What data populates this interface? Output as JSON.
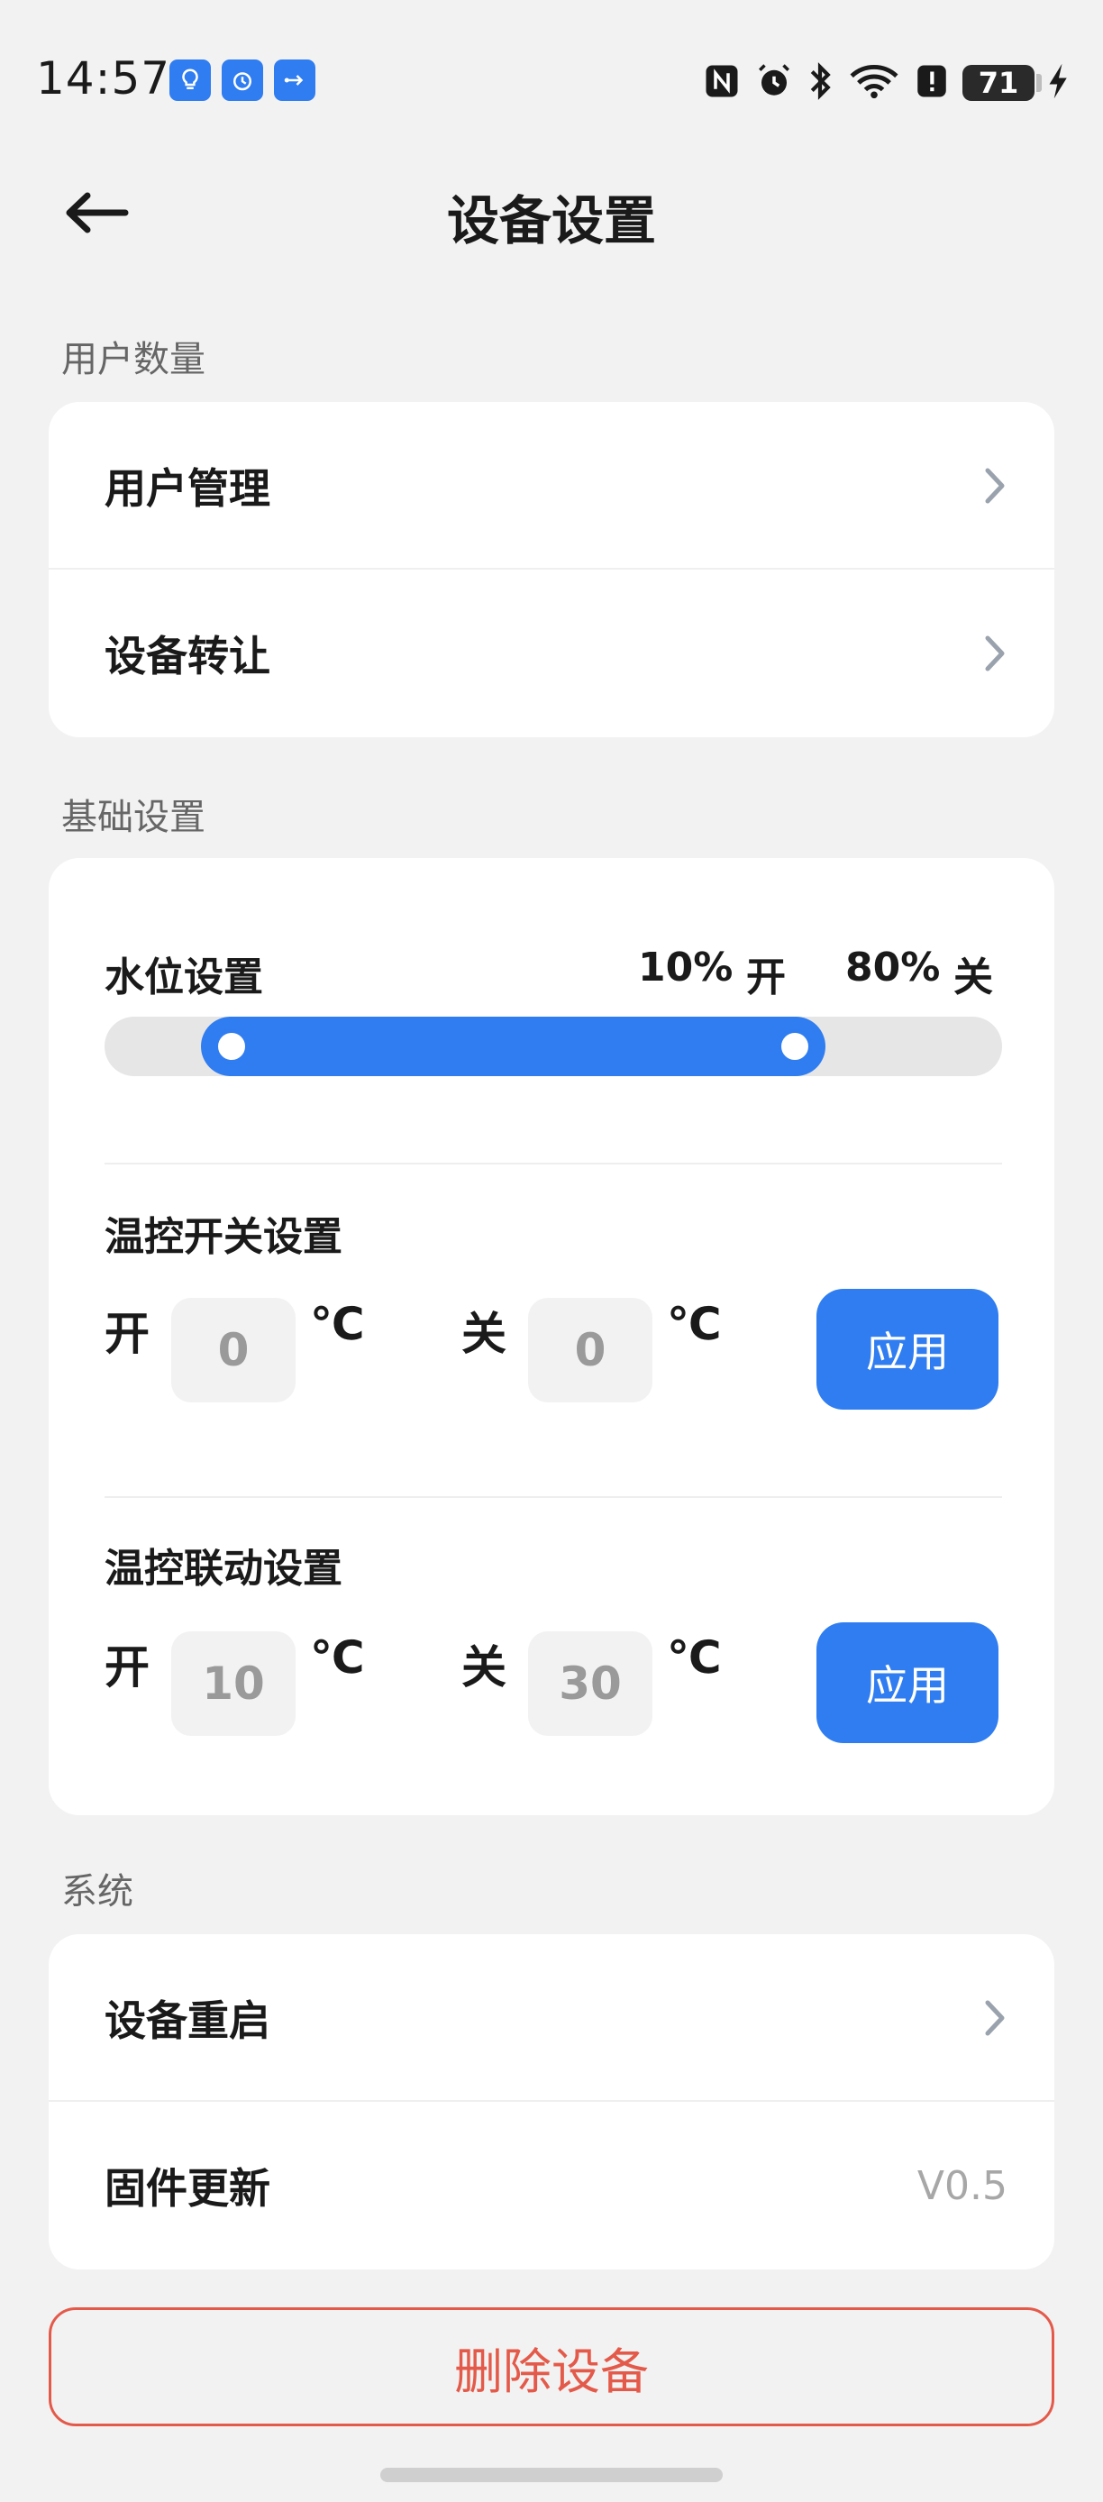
{
  "status_bar": {
    "time": "14:57",
    "app_icons": [
      "bulb-icon",
      "alarm-icon",
      "usb-icon"
    ],
    "right_icons": [
      "nfc-icon",
      "do-not-disturb-icon",
      "bluetooth-icon",
      "wifi-icon",
      "alert-icon"
    ],
    "battery_level": "71",
    "charging_icon": "bolt-icon",
    "accent_color": "#2f7df0"
  },
  "header": {
    "title": "设备设置",
    "back_icon": "back-arrow-icon"
  },
  "sections": {
    "users": {
      "label": "用户数量",
      "items": [
        {
          "label": "用户管理"
        },
        {
          "label": "设备转让"
        }
      ]
    },
    "basic": {
      "label": "基础设置",
      "water_level": {
        "title": "水位设置",
        "on_value": "10%",
        "on_label": "开",
        "off_value": "80%",
        "off_label": "关",
        "range_start_fraction": 0.1,
        "range_end_fraction": 0.8
      },
      "temp_switch": {
        "title": "温控开关设置",
        "on_label": "开",
        "on_value": "0",
        "off_label": "关",
        "off_value": "0",
        "unit": "℃",
        "apply_label": "应用"
      },
      "temp_link": {
        "title": "温控联动设置",
        "on_label": "开",
        "on_value": "10",
        "off_label": "关",
        "off_value": "30",
        "unit": "℃",
        "apply_label": "应用"
      }
    },
    "system": {
      "label": "系统",
      "items": [
        {
          "label": "设备重启"
        },
        {
          "label": "固件更新",
          "value": "V0.5"
        }
      ]
    }
  },
  "delete_button": {
    "label": "删除设备",
    "color": "#e45a4a"
  }
}
